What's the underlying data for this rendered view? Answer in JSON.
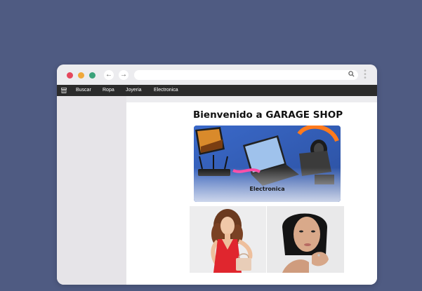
{
  "browser": {
    "url_value": "",
    "icons": {
      "back": "arrow-left-icon",
      "forward": "arrow-right-icon",
      "search": "search-icon",
      "menu": "kebab-menu-icon"
    }
  },
  "nav": {
    "logo_icon": "store-icon",
    "items": [
      {
        "label": "Buscar"
      },
      {
        "label": "Ropa"
      },
      {
        "label": "Joyeria"
      },
      {
        "label": "Electronica"
      }
    ]
  },
  "main": {
    "welcome": "Bienvenido a GARAGE SHOP",
    "banner": {
      "label": "Electronica"
    },
    "gallery": [
      {
        "description_icon": "woman-red-dress-photo"
      },
      {
        "description_icon": "woman-jewelry-photo"
      }
    ]
  },
  "colors": {
    "page_bg": "#4f5b82",
    "menubar_bg": "#2b2b2b",
    "dot_red": "#e5475d",
    "dot_yellow": "#f0a83a",
    "dot_green": "#3aa27a"
  }
}
